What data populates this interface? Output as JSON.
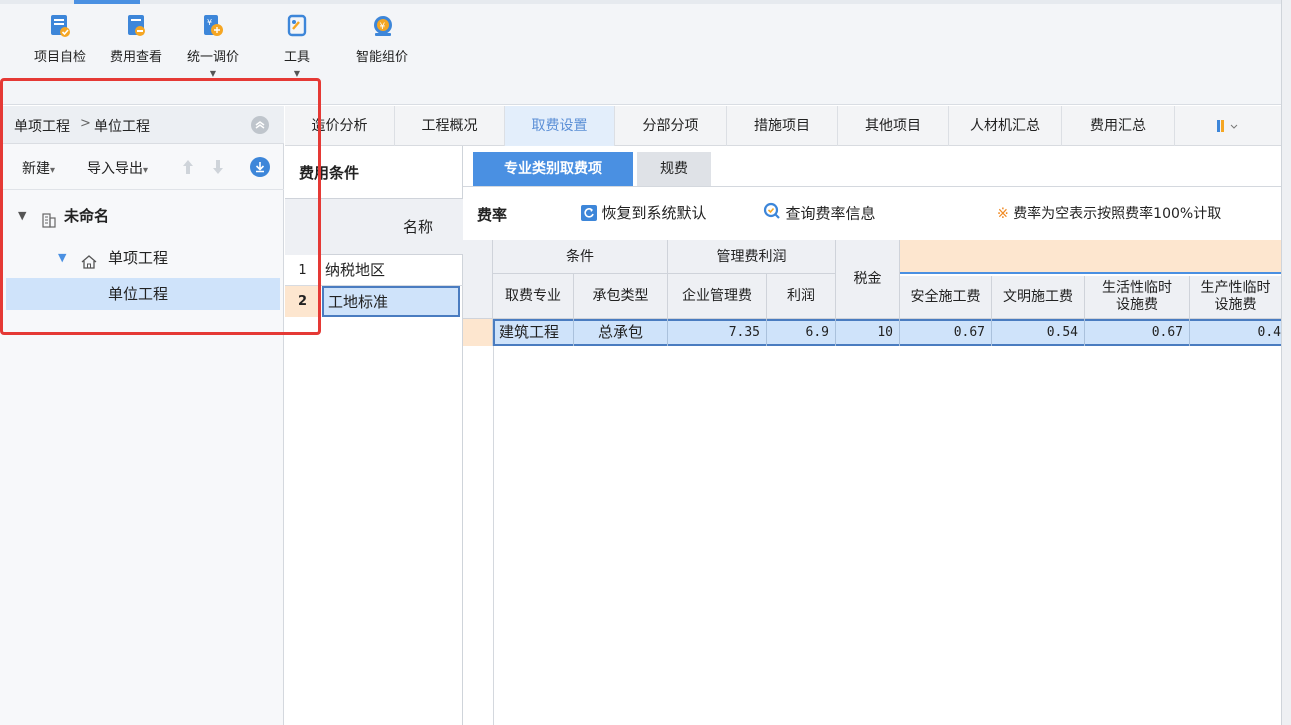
{
  "toolbar": {
    "buttons": [
      {
        "label": "项目自检",
        "icon": "check-document-icon",
        "dropdown": false
      },
      {
        "label": "费用查看",
        "icon": "cost-view-icon",
        "dropdown": false
      },
      {
        "label": "统一调价",
        "icon": "adjust-price-icon",
        "dropdown": true
      },
      {
        "label": "工具",
        "icon": "tools-icon",
        "dropdown": true
      },
      {
        "label": "智能组价",
        "icon": "smart-pricing-icon",
        "dropdown": false
      }
    ],
    "dropdown_glyph": "▼"
  },
  "left_panel": {
    "breadcrumb": {
      "first": "单项工程",
      "sep": ">",
      "second": "单位工程"
    },
    "actions": {
      "new_label": "新建",
      "import_export_label": "导入导出",
      "caret": "▾"
    },
    "tree": {
      "root": "未命名",
      "child": "单项工程",
      "leaf": "单位工程"
    }
  },
  "tabs": [
    "造价分析",
    "工程概况",
    "取费设置",
    "分部分项",
    "措施项目",
    "其他项目",
    "人材机汇总",
    "费用汇总"
  ],
  "active_tab": "取费设置",
  "conditions": {
    "title": "费用条件",
    "column_header": "名称",
    "rows": [
      {
        "index": "1",
        "name": "纳税地区"
      },
      {
        "index": "2",
        "name": "工地标准"
      }
    ]
  },
  "subtabs": [
    "专业类别取费项",
    "规费"
  ],
  "rate_bar": {
    "title": "费率",
    "restore_label": "恢复到系统默认",
    "query_label": "查询费率信息",
    "note_symbol": "※",
    "note": "费率为空表示按照费率100%计取"
  },
  "grid": {
    "group_headers": {
      "condition": "条件",
      "mgmt_profit": "管理费利润"
    },
    "columns": [
      "取费专业",
      "承包类型",
      "企业管理费",
      "利润",
      "税金",
      "安全施工费",
      "文明施工费",
      "生活性临时设施费",
      "生产性临时设施费"
    ],
    "column_lines": {
      "col7": [
        "生活性临时",
        "设施费"
      ],
      "col8": [
        "生产性临时",
        "设施费"
      ]
    },
    "row": {
      "specialty": "建筑工程",
      "contract_type": "总承包",
      "mgmt_fee": "7.35",
      "profit": "6.9",
      "tax": "10",
      "safety": "0.67",
      "civilized": "0.54",
      "living_temp": "0.67",
      "production_temp": "0.4"
    }
  },
  "colors": {
    "accent": "#4a90e2",
    "active_tab_bg": "#e3eefb",
    "selected_row_bg": "#cfe3fa",
    "highlight_header": "#fde6cf",
    "red_annotation": "#e53935"
  }
}
